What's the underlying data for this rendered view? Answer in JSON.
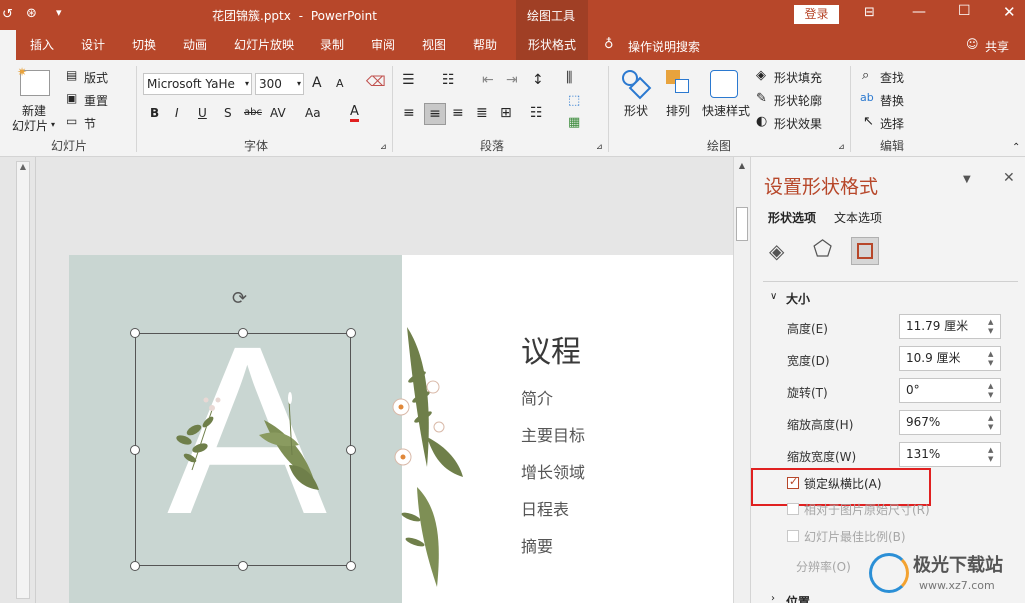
{
  "titlebar": {
    "filename": "花团锦簇.pptx",
    "separator": "-",
    "app": "PowerPoint",
    "context_tool": "绘图工具",
    "login": "登录"
  },
  "tabs": [
    "插入",
    "设计",
    "切换",
    "动画",
    "幻灯片放映",
    "录制",
    "审阅",
    "视图",
    "帮助",
    "形状格式"
  ],
  "active_tab": "形状格式",
  "tell_me": "操作说明搜索",
  "share": "共享",
  "ribbon": {
    "slides": {
      "new_slide_1": "新建",
      "new_slide_2": "幻灯片",
      "layout": "版式",
      "reset": "重置",
      "section": "节",
      "label": "幻灯片"
    },
    "font": {
      "name": "Microsoft YaHe",
      "size": "300",
      "label": "字体",
      "bold": "B",
      "italic": "I",
      "underline": "U",
      "shadow": "S",
      "strike": "abc",
      "spacing": "AV",
      "case": "Aa",
      "grow": "A",
      "shrink": "A",
      "color": "A"
    },
    "paragraph": {
      "label": "段落"
    },
    "drawing": {
      "shapes": "形状",
      "arrange": "排列",
      "quick_styles": "快速样式",
      "fill": "形状填充",
      "outline": "形状轮廓",
      "effects": "形状效果",
      "label": "绘图"
    },
    "editing": {
      "find": "查找",
      "replace": "替换",
      "select": "选择",
      "label": "编辑"
    }
  },
  "slide": {
    "letter": "A",
    "title": "议程",
    "items": [
      "简介",
      "主要目标",
      "增长领域",
      "日程表",
      "摘要"
    ]
  },
  "panel": {
    "title": "设置形状格式",
    "tab_shape": "形状选项",
    "tab_text": "文本选项",
    "section_size": "大小",
    "fields": [
      {
        "label": "高度(E)",
        "value": "11.79 厘米"
      },
      {
        "label": "宽度(D)",
        "value": "10.9 厘米"
      },
      {
        "label": "旋转(T)",
        "value": "0°"
      },
      {
        "label": "缩放高度(H)",
        "value": "967%"
      },
      {
        "label": "缩放宽度(W)",
        "value": "131%"
      }
    ],
    "lock_aspect": "锁定纵横比(A)",
    "lock_aspect_checked": true,
    "relative_original": "相对于图片原始尺寸(R)",
    "best_scale": "幻灯片最佳比例(B)",
    "resolution": "分辨率(O)",
    "section_position": "位置"
  },
  "watermark": {
    "name": "极光下载站",
    "url": "www.xz7.com"
  },
  "colors": {
    "accent": "#b7472a",
    "highlight": "#e02020",
    "slide_bg": "#c9d6d2"
  }
}
